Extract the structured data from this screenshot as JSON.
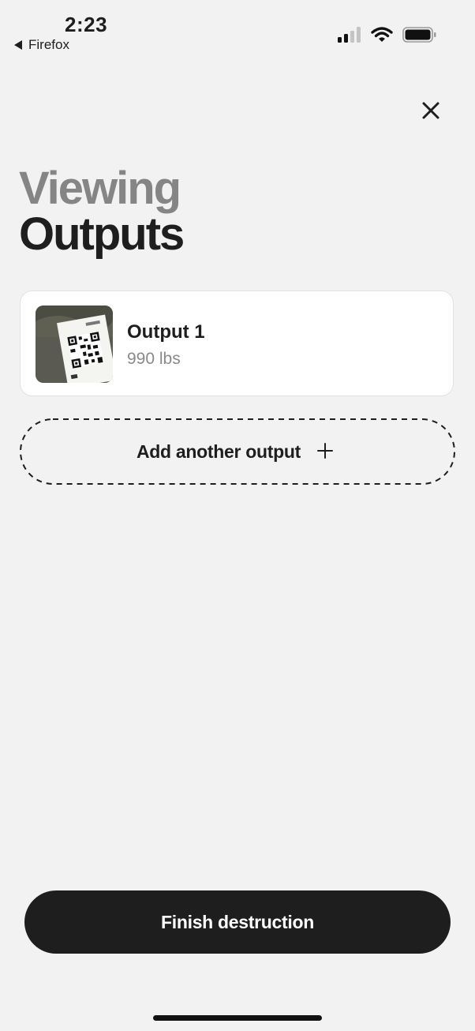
{
  "status_bar": {
    "time": "2:23",
    "back_app": "Firefox",
    "signal_icon": "signal-icon",
    "wifi_icon": "wifi-icon",
    "battery_icon": "battery-icon"
  },
  "header": {
    "title_line1": "Viewing",
    "title_line2": "Outputs",
    "close_icon": "close-icon"
  },
  "outputs": [
    {
      "name": "Output 1",
      "weight": "990 lbs",
      "thumbnail": "qr-tag-photo"
    }
  ],
  "add_button": {
    "label": "Add another output",
    "icon": "plus-icon"
  },
  "footer": {
    "finish_label": "Finish destruction"
  },
  "colors": {
    "background": "#f2f2f2",
    "primary_dark": "#1e1e1e",
    "muted_title": "#858585",
    "muted_text": "#8a8a8a",
    "card": "#ffffff"
  }
}
